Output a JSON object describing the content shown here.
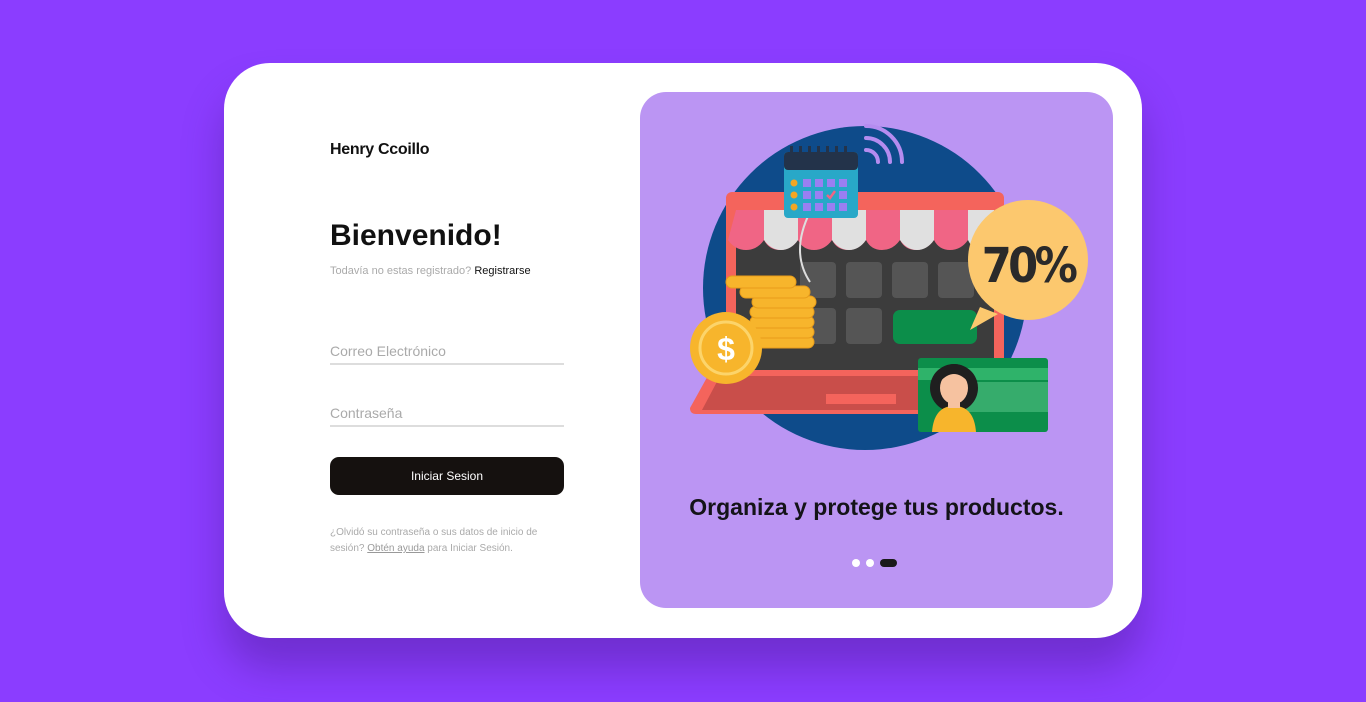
{
  "brand": "Henry Ccoillo",
  "heading": "Bienvenido!",
  "signup": {
    "prompt": "Todavía no estas registrado?",
    "link": "Registrarse"
  },
  "form": {
    "email_placeholder": "Correo Electrónico",
    "password_placeholder": "Contraseña",
    "submit_label": "Iniciar Sesion"
  },
  "help": {
    "before": "¿Olvidó su contraseña o sus datos de inicio de sesión?",
    "link": "Obtén ayuda",
    "after": "para Iniciar Sesión."
  },
  "carousel": {
    "caption": "Organiza y protege tus productos.",
    "discount": "70%",
    "slides": 3,
    "active_slide": 3
  },
  "colors": {
    "background": "#8b3dff",
    "panel": "#bb95f3",
    "button": "#15110f"
  }
}
